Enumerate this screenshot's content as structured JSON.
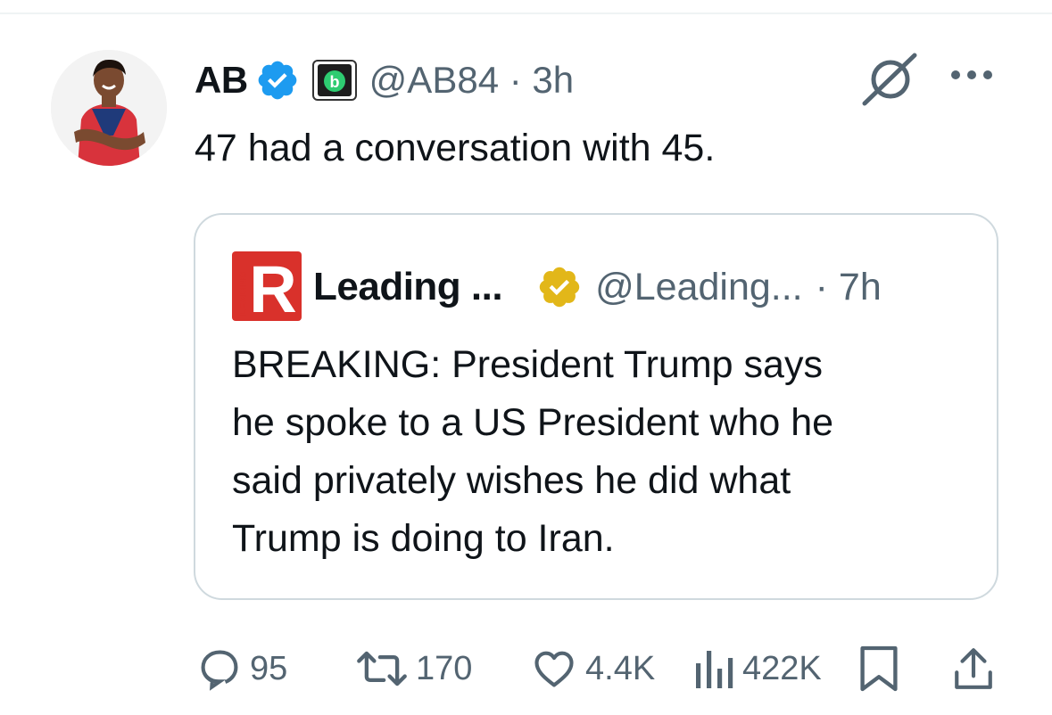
{
  "tweet": {
    "display_name": "AB",
    "handle": "@AB84",
    "separator": "·",
    "time": "3h",
    "text": "47 had a conversation with 45."
  },
  "quote": {
    "name": "Leading ...",
    "handle": "@Leading...",
    "separator": "·",
    "time": "7h",
    "logo_letter": "R",
    "logo_text": "LEADING",
    "text_lines": [
      "BREAKING: President Trump says",
      "he spoke to a US President who he",
      "said privately wishes he did what",
      "Trump is doing to Iran."
    ]
  },
  "actions": {
    "replies": "95",
    "reposts": "170",
    "likes": "4.4K",
    "views": "422K"
  },
  "icons": {
    "verified": "verified-badge-icon",
    "affiliate": "affiliate-badge-icon",
    "grok": "grok-icon",
    "more": "more-icon",
    "reply": "reply-icon",
    "repost": "repost-icon",
    "like": "like-icon",
    "views": "views-icon",
    "bookmark": "bookmark-icon",
    "share": "share-icon"
  },
  "colors": {
    "verified_blue": "#1d9bf0",
    "gold_verified": "#e2b719",
    "secondary_text": "#536471",
    "border": "#cfd9de",
    "brand_red": "#d9312b"
  }
}
